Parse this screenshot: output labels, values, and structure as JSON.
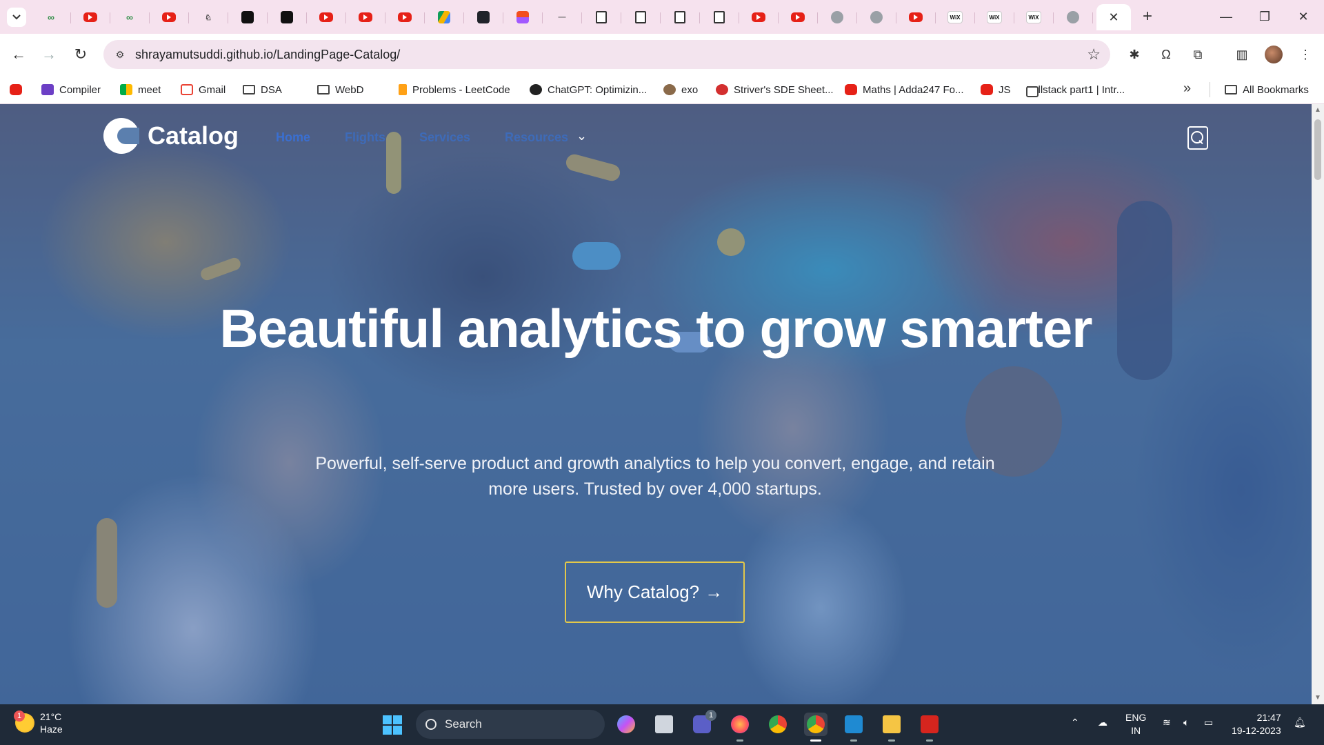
{
  "browser": {
    "url": "shrayamutsuddi.github.io/LandingPage-Catalog/",
    "tabs": [
      {
        "icon": "gfg-icon"
      },
      {
        "icon": "youtube-icon"
      },
      {
        "icon": "gfg-icon"
      },
      {
        "icon": "youtube-icon"
      },
      {
        "icon": "bell-icon"
      },
      {
        "icon": "dark-k-icon"
      },
      {
        "icon": "dark-r-icon"
      },
      {
        "icon": "youtube-icon"
      },
      {
        "icon": "youtube-icon"
      },
      {
        "icon": "youtube-icon"
      },
      {
        "icon": "drive-icon"
      },
      {
        "icon": "react-icon"
      },
      {
        "icon": "figma-icon"
      },
      {
        "icon": "pin-icon"
      },
      {
        "icon": "doc-icon"
      },
      {
        "icon": "doc-icon"
      },
      {
        "icon": "doc-icon"
      },
      {
        "icon": "page-icon"
      },
      {
        "icon": "youtube-icon"
      },
      {
        "icon": "youtube-icon"
      },
      {
        "icon": "globe-icon"
      },
      {
        "icon": "avatar-icon"
      },
      {
        "icon": "youtube-icon"
      },
      {
        "icon": "wix-icon"
      },
      {
        "icon": "wix-icon"
      },
      {
        "icon": "wix-icon"
      },
      {
        "icon": "globe-icon"
      }
    ],
    "wix_label": "WiX",
    "new_tab": "+",
    "close": "✕"
  },
  "bookmarks": [
    {
      "label": "",
      "icon": "yt"
    },
    {
      "label": "Compiler",
      "icon": "compiler"
    },
    {
      "label": "meet",
      "icon": "meet"
    },
    {
      "label": "Gmail",
      "icon": "gmail"
    },
    {
      "label": "DSA",
      "icon": "folder"
    },
    {
      "label": "WebD",
      "icon": "folder"
    },
    {
      "label": "Problems - LeetCode",
      "icon": "leet"
    },
    {
      "label": "ChatGPT: Optimizin...",
      "icon": "chatgpt"
    },
    {
      "label": "exo",
      "icon": "exo"
    },
    {
      "label": "Striver's SDE Sheet...",
      "icon": "striver"
    },
    {
      "label": "Maths | Adda247 Fo...",
      "icon": "yt"
    },
    {
      "label": "JS",
      "icon": "yt"
    },
    {
      "label": "Fullstack part1 | Intr...",
      "icon": "tab"
    }
  ],
  "all_bookmarks": "All Bookmarks",
  "site": {
    "brand": "Catalog",
    "nav": [
      "Home",
      "Flights",
      "Services",
      "Resources"
    ],
    "headline": "Beautiful analytics to grow smarter",
    "subtitle": "Powerful, self-serve product and growth analytics to help you convert, engage, and retain more users. Trusted by over 4,000 startups.",
    "cta": "Why Catalog?",
    "cta_arrow": "→",
    "colors": {
      "overlay": "#4a6fa8",
      "nav_active": "#3a6fd1",
      "cta_border": "#e3c84a"
    }
  },
  "taskbar": {
    "weather_temp": "21°C",
    "weather_cond": "Haze",
    "weather_badge": "1",
    "search": "Search",
    "teams_badge": "1",
    "lang_top": "ENG",
    "lang_bottom": "IN",
    "time": "21:47",
    "date": "19-12-2023"
  }
}
